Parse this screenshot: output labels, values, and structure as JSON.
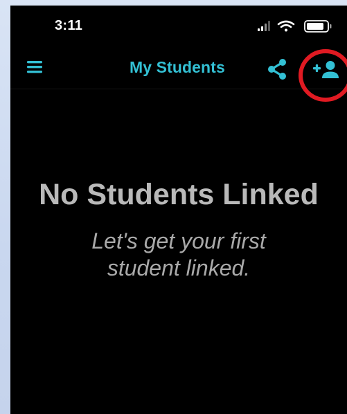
{
  "status_bar": {
    "time": "3:11"
  },
  "header": {
    "title": "My Students",
    "menu_icon": "hamburger-menu-icon",
    "share_icon": "share-icon",
    "add_icon": "add-person-icon"
  },
  "empty_state": {
    "title": "No Students Linked",
    "subtitle": "Let's get your first student linked."
  },
  "colors": {
    "accent": "#33c0d4",
    "background": "#000000",
    "empty_title": "#b9b9b9",
    "empty_subtitle": "#a9a9a9",
    "annotation": "#e01a22"
  }
}
